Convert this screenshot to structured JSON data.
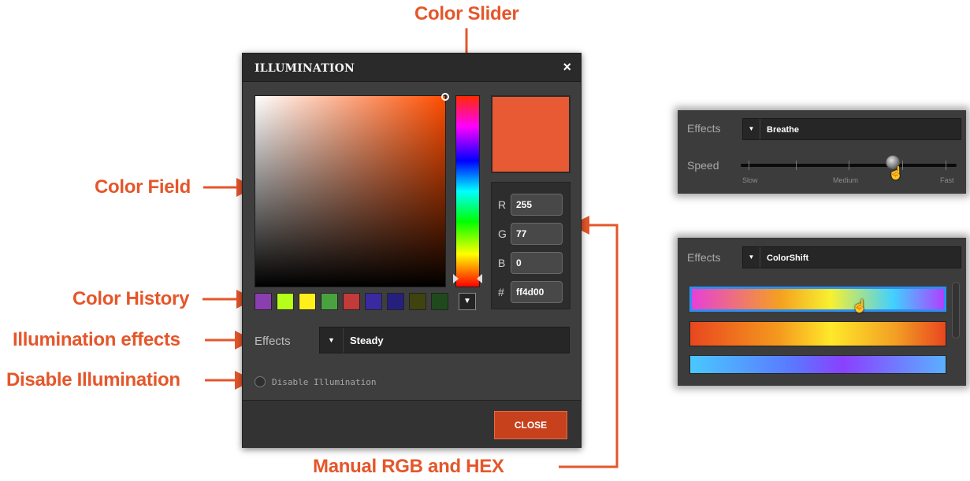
{
  "callouts": {
    "color_slider": "Color Slider",
    "color_field": "Color Field",
    "color_history": "Color History",
    "illumination_effects": "Illumination effects",
    "disable_illumination": "Disable Illumination",
    "manual_rgb_hex": "Manual RGB and HEX"
  },
  "dialog": {
    "title": "ILLUMINATION",
    "close_glyph": "×",
    "selected_color": "#e75a33",
    "values": {
      "r_label": "R",
      "r": "255",
      "g_label": "G",
      "g": "77",
      "b_label": "B",
      "b": "0",
      "hex_label": "#",
      "hex": "ff4d00"
    },
    "history_colors": [
      "#8a3fb0",
      "#b6ff1a",
      "#ffef1a",
      "#4aa23f",
      "#c23a3a",
      "#3a2aa0",
      "#25207e",
      "#3f4310",
      "#1f4a1d"
    ],
    "history_dropdown_glyph": "▼",
    "effects_label": "Effects",
    "effects_caret": "▼",
    "effects_value": "Steady",
    "disable_label": "Disable Illumination",
    "close_button": "CLOSE"
  },
  "breathe_panel": {
    "effects_label": "Effects",
    "effects_value": "Breathe",
    "caret": "▼",
    "speed_label": "Speed",
    "speed_ticks": [
      "Slow",
      "Medium",
      "Fast"
    ],
    "speed_level": 0.67
  },
  "colorshift_panel": {
    "effects_label": "Effects",
    "effects_value": "ColorShift",
    "caret": "▼"
  },
  "colors": {
    "accent": "#e5562a",
    "dialog_bg": "#3e3e3e",
    "close_button": "#c8411d"
  }
}
